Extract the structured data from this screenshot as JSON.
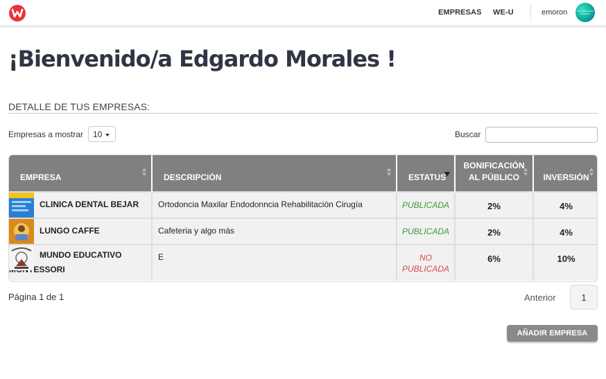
{
  "nav": {
    "links": [
      "EMPRESAS",
      "WE-U"
    ],
    "username": "emoron",
    "avatar_text": "GIVE BRANDED CHANNEL"
  },
  "page": {
    "title": "¡Bienvenido/a Edgardo Morales !",
    "section_title": "DETALLE DE TUS EMPRESAS:"
  },
  "controls": {
    "show_label": "Empresas a mostrar",
    "show_value": "10",
    "search_label": "Buscar",
    "search_value": ""
  },
  "table": {
    "headers": [
      "EMPRESA",
      "DESCRIPCIÓN",
      "ESTATUS",
      "BONIFICACIÓN AL PÚBLICO",
      "INVERSIÓN"
    ],
    "rows": [
      {
        "empresa": "CLINICA DENTAL BEJAR",
        "descripcion": "Ortodoncia Maxilar Endodonncia Rehabilitación Cirugía",
        "estatus": "PUBLICADA",
        "bonificacion": "2%",
        "inversion": "4%"
      },
      {
        "empresa": "LUNGO CAFFE",
        "descripcion": "Cafeteria y algo más",
        "estatus": "PUBLICADA",
        "bonificacion": "2%",
        "inversion": "4%"
      },
      {
        "empresa_line1": "MUNDO EDUCATIVO",
        "empresa_line2": "MONTESSORI",
        "descripcion": "E",
        "estatus_line1": "NO",
        "estatus_line2": "PUBLICADA",
        "bonificacion": "6%",
        "inversion": "10%"
      }
    ]
  },
  "pagination": {
    "info": "Página 1 de 1",
    "prev_label": "Anterior",
    "current_page": "1"
  },
  "actions": {
    "add_label": "AÑADIR EMPRESA"
  },
  "colors": {
    "header_bg": "#808080",
    "published": "#3a9a3a",
    "unpublished": "#e04848",
    "brand": "#e8333a"
  }
}
